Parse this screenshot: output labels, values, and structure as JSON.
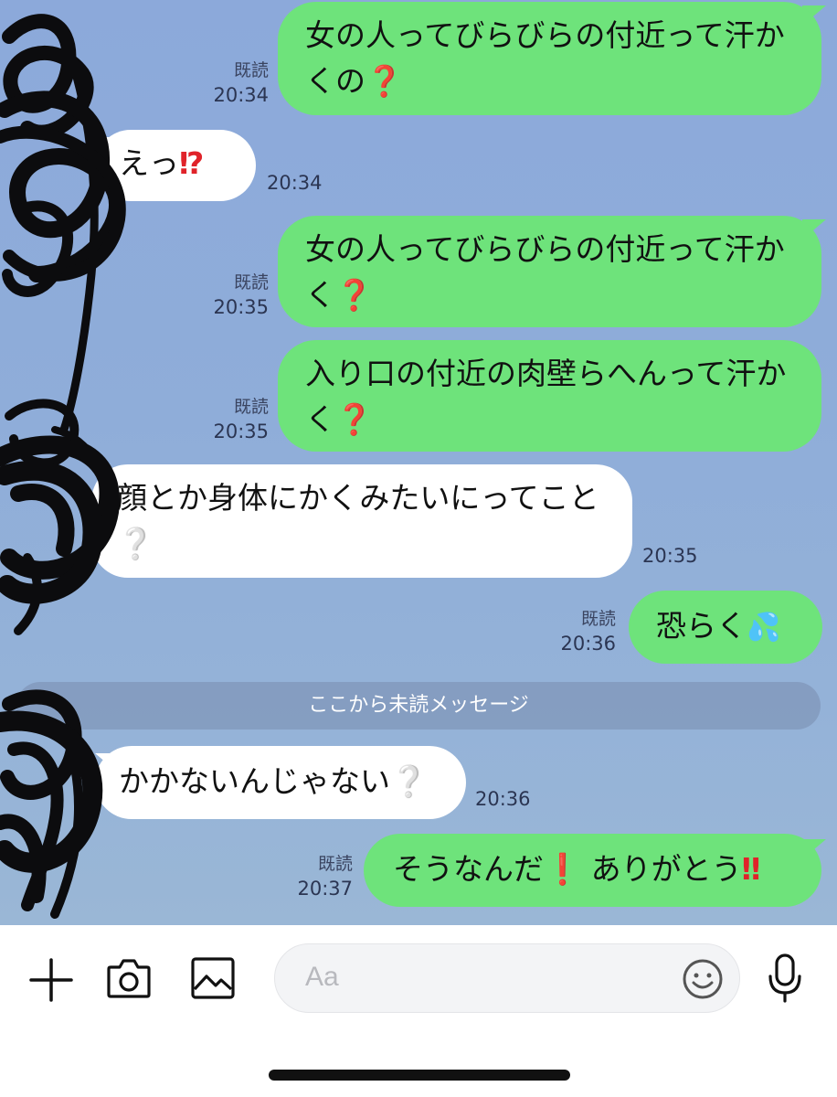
{
  "messages": [
    {
      "id": "m1",
      "dir": "out",
      "text": "女の人ってびらびらの付近って汗かくの",
      "emoji": "❓",
      "read": "既読",
      "time": "20:34"
    },
    {
      "id": "m2",
      "dir": "in",
      "text": "えっ",
      "emoji": "⁉",
      "time": "20:34"
    },
    {
      "id": "m3",
      "dir": "out",
      "text": "女の人ってびらびらの付近って汗かく",
      "emoji": "❓",
      "read": "既読",
      "time": "20:35"
    },
    {
      "id": "m4",
      "dir": "out",
      "text": "入り口の付近の肉壁らへんって汗かく",
      "emoji": "❓",
      "read": "既読",
      "time": "20:35"
    },
    {
      "id": "m5",
      "dir": "in",
      "text": "顔とか身体にかくみたいにってこと",
      "emoji": "❔",
      "time": "20:35"
    },
    {
      "id": "m6",
      "dir": "out",
      "text": "恐らく",
      "emoji": "💦",
      "read": "既読",
      "time": "20:36"
    },
    {
      "id": "m7",
      "dir": "in",
      "text": "かかないんじゃない",
      "emoji": "❔",
      "time": "20:36"
    },
    {
      "id": "m8",
      "dir": "out",
      "text_a": "そうなんだ",
      "emoji_a": "❗",
      "text_b": "ありがとう",
      "emoji_b": "‼",
      "read": "既読",
      "time": "20:37"
    }
  ],
  "divider": {
    "label": "ここから未読メッセージ"
  },
  "input": {
    "placeholder": "Aa"
  },
  "icons": [
    "plus-icon",
    "camera-icon",
    "image-icon",
    "emoji-icon",
    "microphone-icon"
  ],
  "colors": {
    "outgoing_bubble": "#6ee37b",
    "incoming_bubble": "#ffffff",
    "chat_background": "#8fadd9",
    "accent_red": "#e0232a"
  }
}
